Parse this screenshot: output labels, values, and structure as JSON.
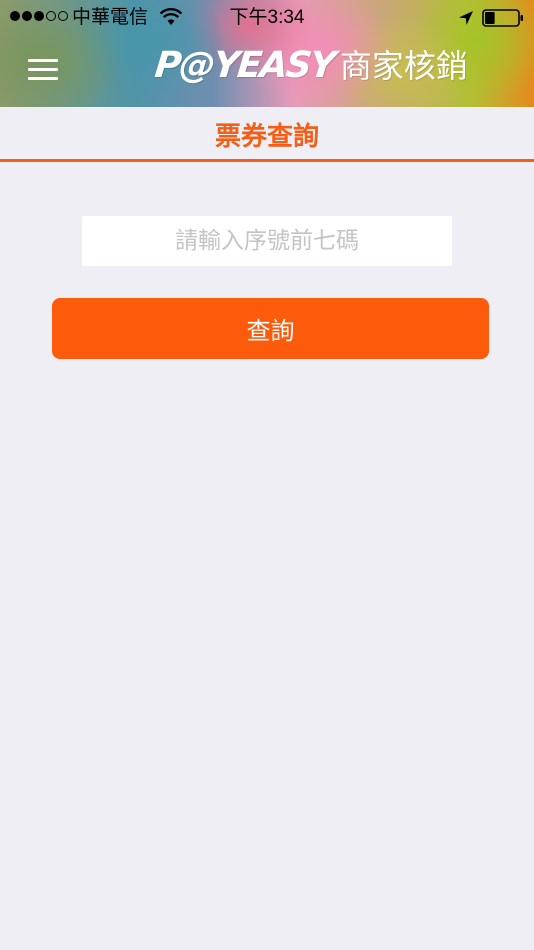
{
  "status_bar": {
    "signal_icon": "signal-dots-icon",
    "signal_strength": 3,
    "signal_max": 5,
    "carrier": "中華電信",
    "wifi_icon": "wifi-icon",
    "time": "下午3:34",
    "location_icon": "location-arrow-icon",
    "battery_icon": "battery-icon",
    "battery_level": 0.3
  },
  "nav_bar": {
    "menu_icon": "hamburger-menu-icon",
    "brand_logo": "P@YEASY",
    "title": "商家核銷"
  },
  "page": {
    "section_title": "票券查詢"
  },
  "form": {
    "serial_input": {
      "value": "",
      "placeholder": "請輸入序號前七碼"
    },
    "query_button_label": "查詢"
  },
  "colors": {
    "accent": "#f45f17",
    "button": "#fb5b0b",
    "background": "#efeef4",
    "input_background": "#ffffff",
    "placeholder": "#c3c3c8"
  }
}
